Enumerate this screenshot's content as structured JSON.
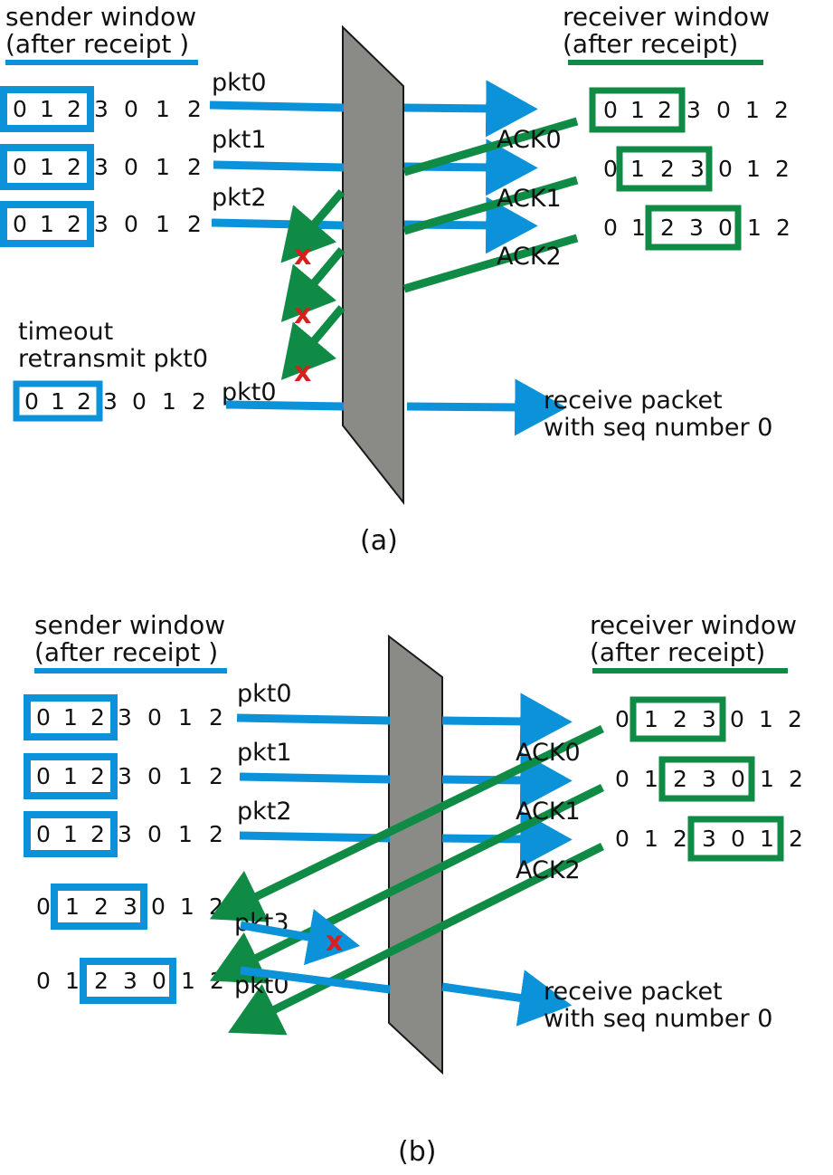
{
  "colors": {
    "sender_blue": "#0b92d8",
    "receiver_green": "#0f8b46",
    "loss_red": "#d6201c",
    "medium_gray": "#8a8a87",
    "text_black": "#111111",
    "background": "#ffffff"
  },
  "panels": [
    {
      "letter": "(a)",
      "sender": {
        "title_line1": "sender window",
        "title_line2": "(after receipt )",
        "rows": [
          {
            "seq": [
              "0",
              "1",
              "2",
              "3",
              "0",
              "1",
              "2"
            ],
            "window_start": 0,
            "window_len": 3
          },
          {
            "seq": [
              "0",
              "1",
              "2",
              "3",
              "0",
              "1",
              "2"
            ],
            "window_start": 0,
            "window_len": 3
          },
          {
            "seq": [
              "0",
              "1",
              "2",
              "3",
              "0",
              "1",
              "2"
            ],
            "window_start": 0,
            "window_len": 3
          },
          {
            "seq": [
              "0",
              "1",
              "2",
              "3",
              "0",
              "1",
              "2"
            ],
            "window_start": 0,
            "window_len": 3
          }
        ]
      },
      "receiver": {
        "title_line1": "receiver window",
        "title_line2": "(after receipt)",
        "rows": [
          {
            "seq": [
              "0",
              "1",
              "2",
              "3",
              "0",
              "1",
              "2"
            ],
            "window_start": 0,
            "window_len": 3
          },
          {
            "seq": [
              "0",
              "1",
              "2",
              "3",
              "0",
              "1",
              "2"
            ],
            "window_start": 1,
            "window_len": 3
          },
          {
            "seq": [
              "0",
              "1",
              "2",
              "3",
              "0",
              "1",
              "2"
            ],
            "window_start": 2,
            "window_len": 3
          }
        ]
      },
      "packet_labels": [
        "pkt0",
        "pkt1",
        "pkt2"
      ],
      "ack_labels": [
        "ACK0",
        "ACK1",
        "ACK2"
      ],
      "timeout_note_line1": "timeout",
      "timeout_note_line2": "retransmit pkt0",
      "retransmit_label": "pkt0",
      "receive_note_line1": "receive packet",
      "receive_note_line2": "with seq number 0",
      "loss_marks": 3,
      "loss_glyph": "x"
    },
    {
      "letter": "(b)",
      "sender": {
        "title_line1": "sender window",
        "title_line2": "(after receipt )",
        "rows": [
          {
            "seq": [
              "0",
              "1",
              "2",
              "3",
              "0",
              "1",
              "2"
            ],
            "window_start": 0,
            "window_len": 3
          },
          {
            "seq": [
              "0",
              "1",
              "2",
              "3",
              "0",
              "1",
              "2"
            ],
            "window_start": 0,
            "window_len": 3
          },
          {
            "seq": [
              "0",
              "1",
              "2",
              "3",
              "0",
              "1",
              "2"
            ],
            "window_start": 0,
            "window_len": 3
          },
          {
            "seq": [
              "0",
              "1",
              "2",
              "3",
              "0",
              "1",
              "2"
            ],
            "window_start": 1,
            "window_len": 3
          },
          {
            "seq": [
              "0",
              "1",
              "2",
              "3",
              "0",
              "1",
              "2"
            ],
            "window_start": 2,
            "window_len": 3
          }
        ]
      },
      "receiver": {
        "title_line1": "receiver window",
        "title_line2": "(after receipt)",
        "rows": [
          {
            "seq": [
              "0",
              "1",
              "2",
              "3",
              "0",
              "1",
              "2"
            ],
            "window_start": 1,
            "window_len": 3
          },
          {
            "seq": [
              "0",
              "1",
              "2",
              "3",
              "0",
              "1",
              "2"
            ],
            "window_start": 2,
            "window_len": 3
          },
          {
            "seq": [
              "0",
              "1",
              "2",
              "3",
              "0",
              "1",
              "2"
            ],
            "window_start": 3,
            "window_len": 3
          }
        ]
      },
      "packet_labels": [
        "pkt0",
        "pkt1",
        "pkt2"
      ],
      "ack_labels": [
        "ACK0",
        "ACK1",
        "ACK2"
      ],
      "lower_packet_labels": [
        "pkt3",
        "pkt0"
      ],
      "receive_note_line1": "receive packet",
      "receive_note_line2": "with seq number 0",
      "loss_marks": 1,
      "loss_glyph": "x"
    }
  ]
}
